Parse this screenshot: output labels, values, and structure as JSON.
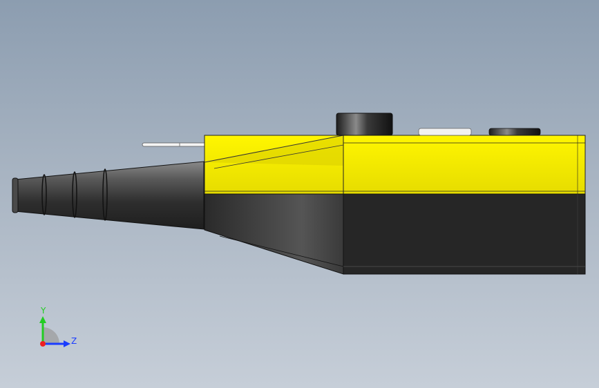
{
  "viewport": {
    "background_top": "#8c9db0",
    "background_bottom": "#c6ced8"
  },
  "model": {
    "housing_color": "#f2ea00",
    "lower_body_color": "#262626",
    "cable_color": "#3a3a3a"
  },
  "triad": {
    "y_label": "Y",
    "z_label": "Z",
    "y_color": "#22cc22",
    "z_color": "#1a3cff",
    "x_color": "#ee2020"
  }
}
